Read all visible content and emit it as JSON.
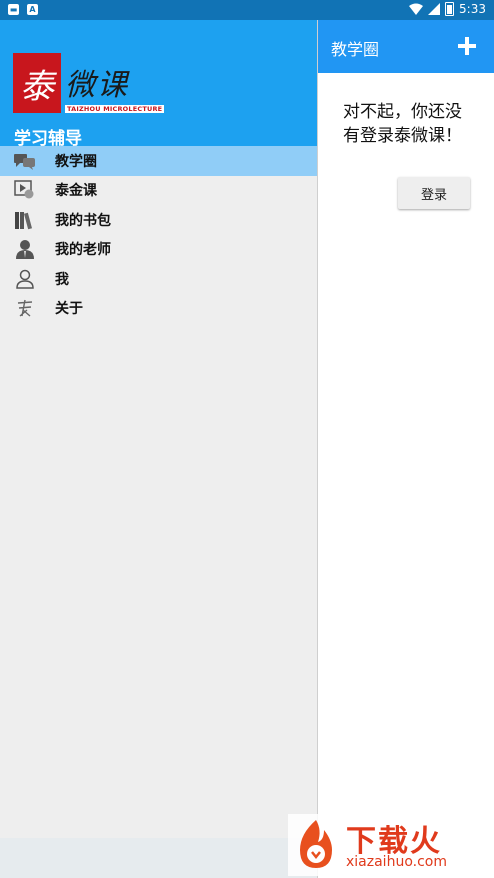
{
  "status_bar": {
    "time": "5:33",
    "left_icons": [
      "notification-icon",
      "a-icon"
    ],
    "right_icons": [
      "wifi-icon",
      "signal-icon",
      "battery-icon"
    ]
  },
  "drawer": {
    "logo": {
      "mark": "泰",
      "text": "微课",
      "subtitle": "TAIZHOU MICROLECTURE"
    },
    "section_title": "学习辅导",
    "items": [
      {
        "label": "教学圈",
        "icon": "chat-bubbles-icon",
        "active": true
      },
      {
        "label": "泰金课",
        "icon": "video-play-icon",
        "active": false
      },
      {
        "label": "我的书包",
        "icon": "books-icon",
        "active": false
      },
      {
        "label": "我的老师",
        "icon": "teacher-icon",
        "active": false
      },
      {
        "label": "我",
        "icon": "person-icon",
        "active": false
      },
      {
        "label": "关于",
        "icon": "tai-logo-icon",
        "active": false
      }
    ]
  },
  "main": {
    "title": "教学圈",
    "add_icon": "plus-icon",
    "message": "对不起，你还没有登录泰微课！",
    "login_label": "登录"
  },
  "watermark": {
    "title": "下载火",
    "url": "xiazaihuo.com"
  },
  "colors": {
    "status_bar": "#1173b5",
    "drawer_header": "#1da1f0",
    "app_bar": "#2196f3",
    "active_item": "#90cdf7",
    "logo_red": "#c8161d"
  }
}
